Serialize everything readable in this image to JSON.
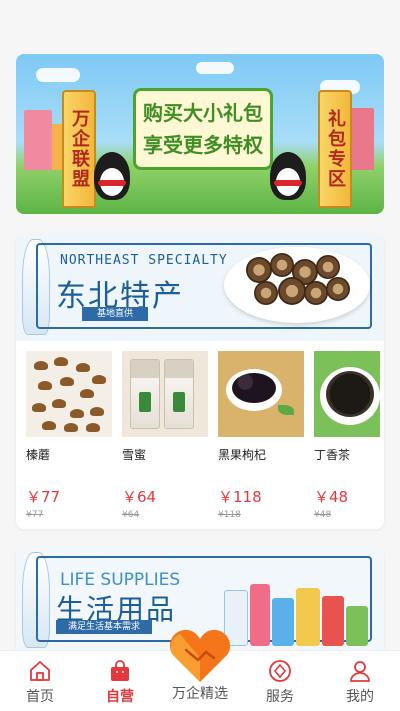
{
  "promo_banner": {
    "left_pillar": "万企联盟",
    "right_pillar": "礼包专区",
    "headline_1": "购买大小礼包",
    "headline_2": "享受更多特权"
  },
  "sections": [
    {
      "en_title": "NORTHEAST SPECIALTY",
      "cn_title": "东北特产",
      "tag": "基地直供",
      "products": [
        {
          "name": "榛蘑",
          "price": "￥77",
          "original_price": "¥77"
        },
        {
          "name": "雪蜜",
          "price": "￥64",
          "original_price": "¥64"
        },
        {
          "name": "黑果枸杞",
          "price": "￥118",
          "original_price": "¥118"
        },
        {
          "name": "丁香茶",
          "price": "￥48",
          "original_price": "¥48"
        }
      ]
    },
    {
      "en_title": "LIFE SUPPLIES",
      "cn_title": "生活用品",
      "tag": "满足生活基本需求"
    }
  ],
  "nav": {
    "items": [
      {
        "label": "首页",
        "icon": "home-icon"
      },
      {
        "label": "自营",
        "icon": "shopping-bag-icon",
        "active": true
      },
      {
        "label": "万企精选",
        "icon": "handshake-heart-icon"
      },
      {
        "label": "服务",
        "icon": "service-icon"
      },
      {
        "label": "我的",
        "icon": "user-icon"
      }
    ]
  },
  "colors": {
    "accent": "#e4393c",
    "brand_blue": "#1c5d9a",
    "heart_orange": "#f5761a"
  }
}
